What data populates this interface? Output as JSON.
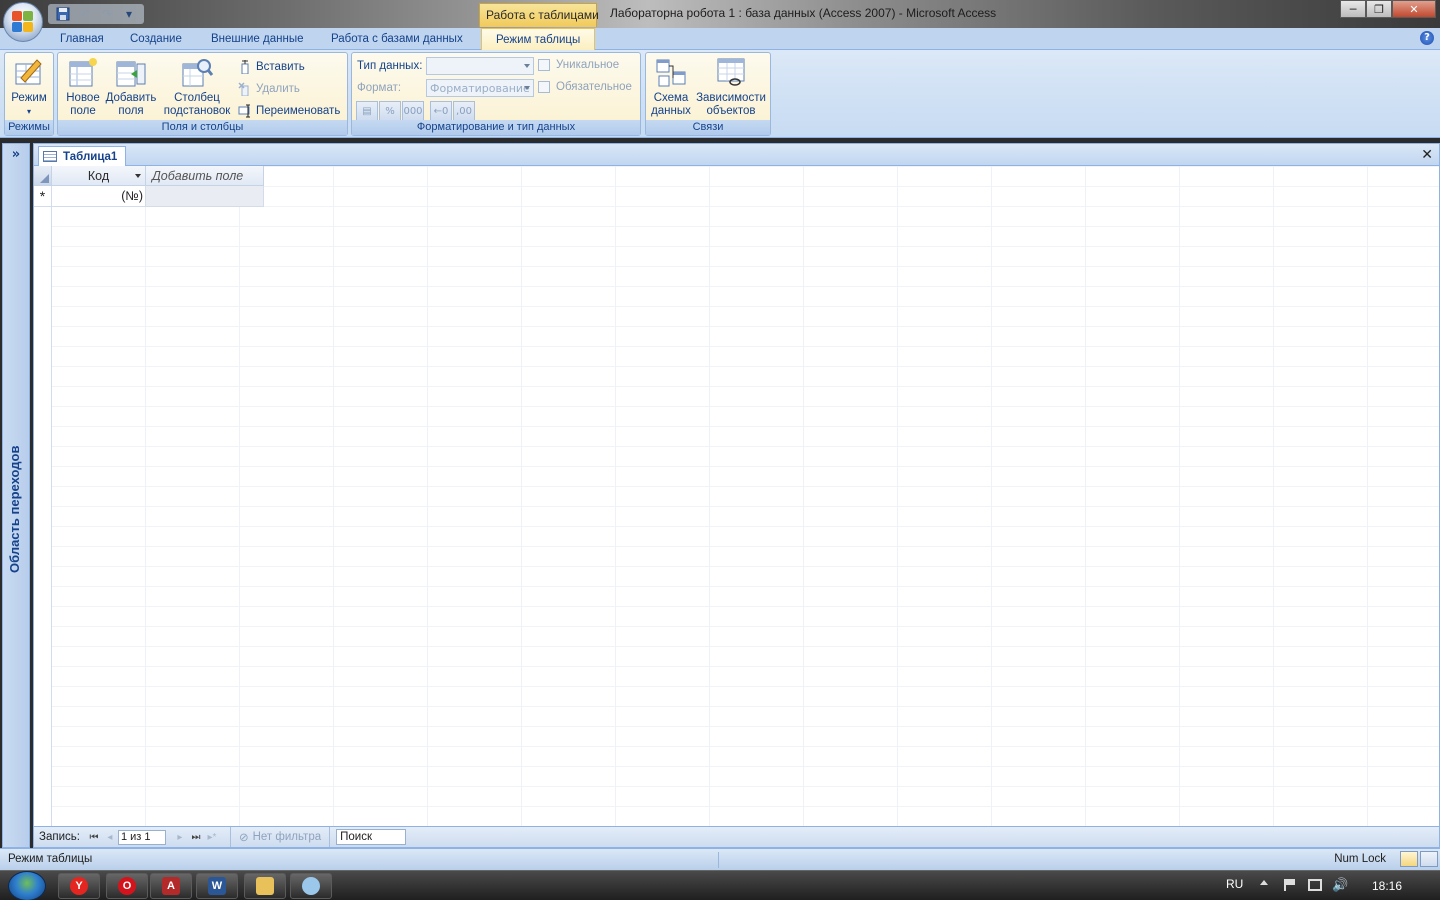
{
  "titlebar": {
    "context_tab_title": "Работа с таблицами",
    "app_title": "Лабораторна робота 1 : база данных (Access 2007)  -  Microsoft Access"
  },
  "ribbon_tabs": [
    {
      "label": "Главная"
    },
    {
      "label": "Создание"
    },
    {
      "label": "Внешние данные"
    },
    {
      "label": "Работа с базами данных"
    },
    {
      "label": "Режим таблицы",
      "active": true
    }
  ],
  "ribbon": {
    "views_group": {
      "label": "Режимы",
      "view_button": "Режим"
    },
    "fields_group": {
      "label": "Поля и столбцы",
      "new_field": "Новое\nполе",
      "new_field_l1": "Новое",
      "new_field_l2": "поле",
      "add_fields_l1": "Добавить",
      "add_fields_l2": "поля",
      "lookup_l1": "Столбец",
      "lookup_l2": "подстановок",
      "insert": "Вставить",
      "delete": "Удалить",
      "rename": "Переименовать"
    },
    "format_group": {
      "label": "Форматирование и тип данных",
      "data_type_label": "Тип данных:",
      "data_type_value": "",
      "format_label": "Формат:",
      "format_value": "Форматирование",
      "unique": "Уникальное",
      "required": "Обязательное",
      "buttons": [
        "%",
        "000",
        ",00"
      ]
    },
    "relations_group": {
      "label": "Связи",
      "schema_l1": "Схема",
      "schema_l2": "данных",
      "deps_l1": "Зависимости",
      "deps_l2": "объектов"
    }
  },
  "nav_pane": {
    "toggle": "»",
    "label": "Область переходов"
  },
  "document": {
    "tab_title": "Таблица1",
    "columns": [
      "Код",
      "Добавить поле"
    ],
    "new_row_marker": "*",
    "new_row_id": "(№)"
  },
  "record_nav": {
    "label": "Запись:",
    "position": "1 из 1",
    "filter": "Нет фильтра",
    "search": "Поиск"
  },
  "statusbar": {
    "mode": "Режим таблицы",
    "numlock": "Num Lock"
  },
  "taskbar": {
    "lang": "RU",
    "clock": "18:16"
  },
  "colors": {
    "ribbon_blue": "#15428b",
    "context_tab": "#f1c95a"
  }
}
